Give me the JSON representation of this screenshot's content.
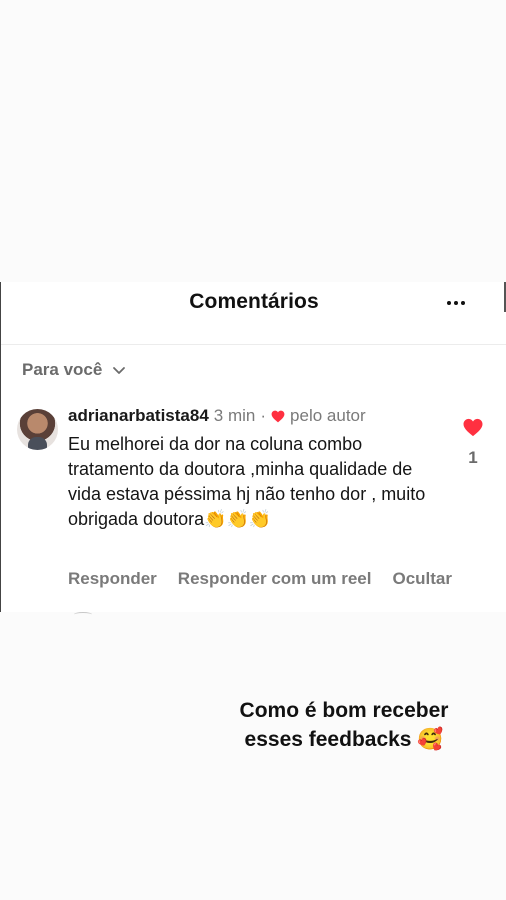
{
  "header": {
    "title": "Comentários"
  },
  "filter": {
    "label": "Para você"
  },
  "comment": {
    "username": "adrianarbatista84",
    "time": "3 min",
    "separator": "·",
    "liked_by_author": "pelo autor",
    "text": "Eu melhorei da dor na coluna combo tratamento da doutora ,minha qualidade de vida estava péssima hj não tenho dor , muito obrigada doutora👏👏👏",
    "like_count": "1"
  },
  "actions": {
    "reply": "Responder",
    "reply_reel": "Responder com um reel",
    "hide": "Ocultar"
  },
  "caption": {
    "line1": "Como é bom receber",
    "line2": "esses feedbacks 🥰"
  },
  "colors": {
    "heart": "#ff3040",
    "muted_text": "#7a7a7a"
  }
}
